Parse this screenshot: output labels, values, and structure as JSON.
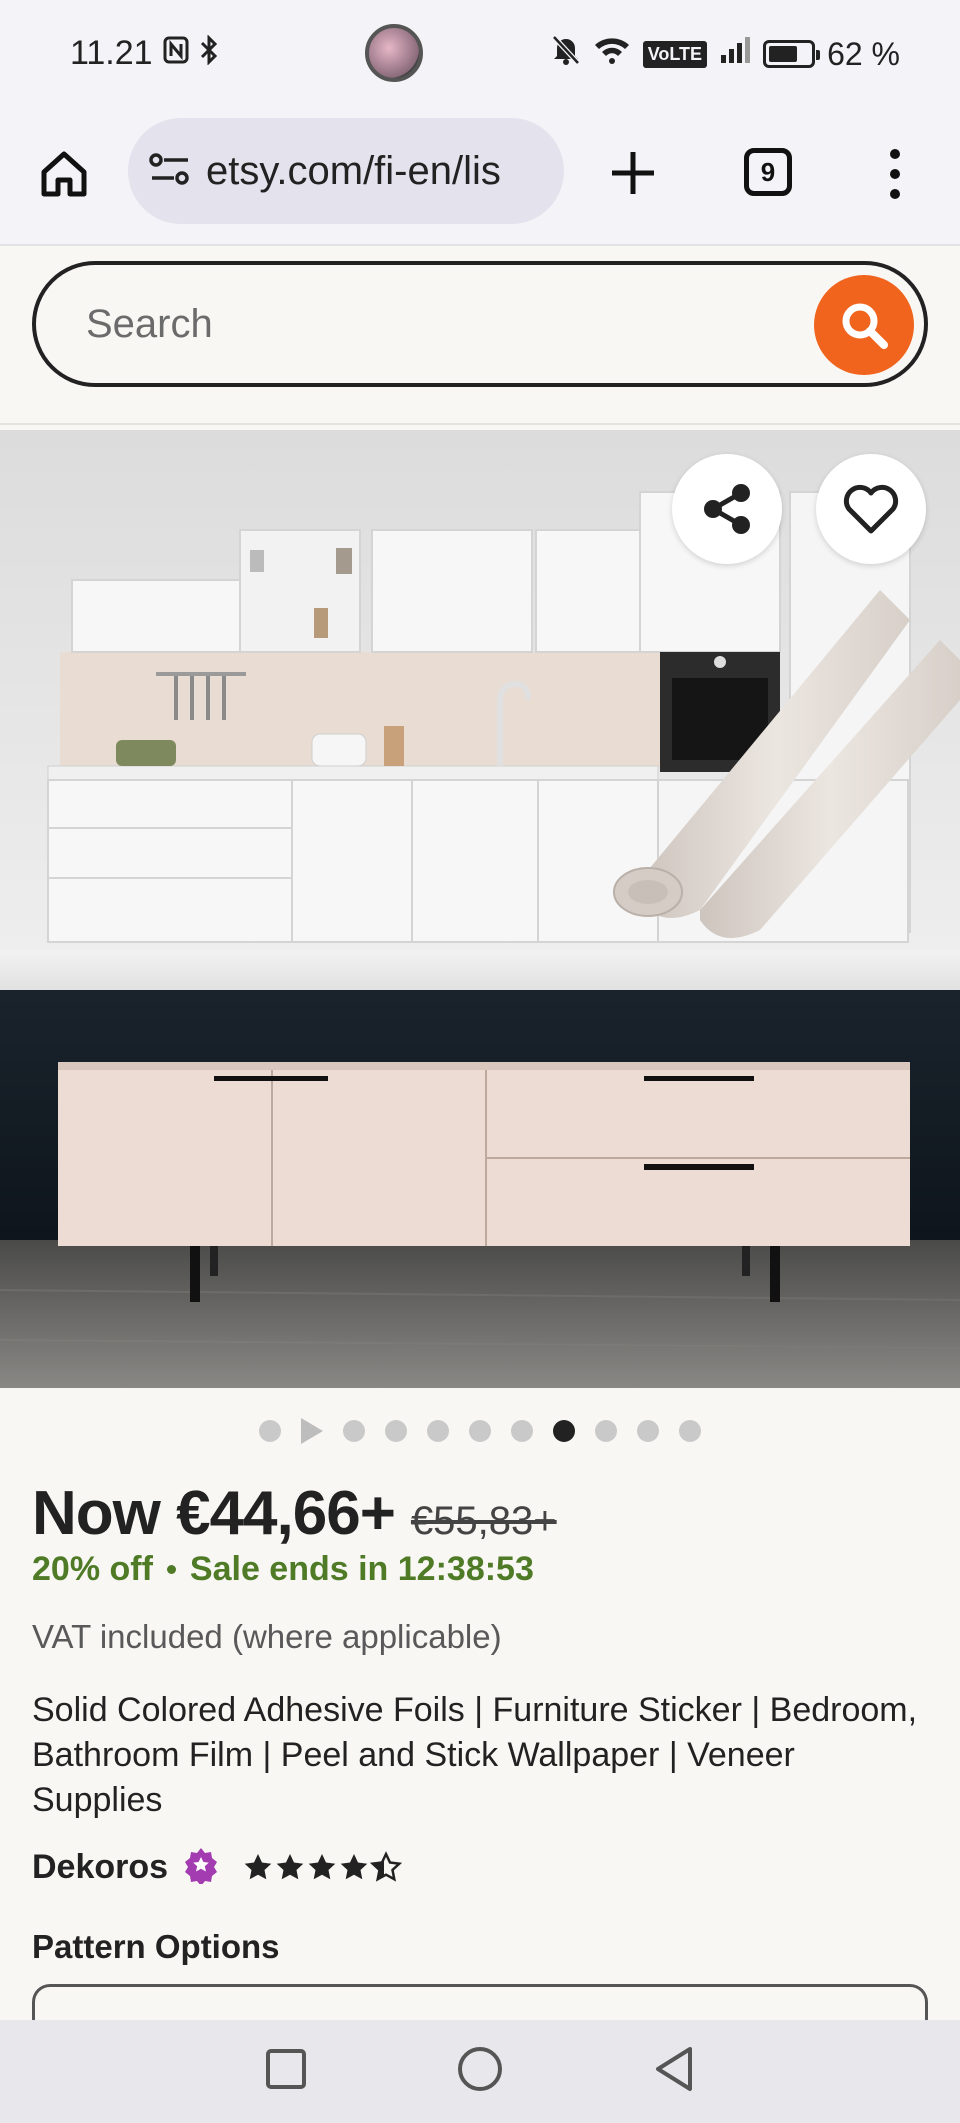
{
  "status_bar": {
    "time": "11.21",
    "battery": "62 %",
    "volte": "VoLTE"
  },
  "browser": {
    "url": "etsy.com/fi-en/lis",
    "tab_count": "9"
  },
  "search": {
    "placeholder": "Search"
  },
  "gallery": {
    "dot_count": 11,
    "active_index": 7
  },
  "listing": {
    "price_now": "Now €44,66+",
    "price_old": "€55,83+",
    "discount": "20% off",
    "sale_ends": "Sale ends in 12:38:53",
    "vat_note": "VAT included (where applicable)",
    "title": "Solid Colored Adhesive Foils | Furniture Sticker | Bedroom, Bathroom Film | Peel and Stick Wallpaper | Veneer Supplies",
    "shop_name": "Dekoros",
    "rating": 4.5,
    "pattern_label": "Pattern Options"
  },
  "colors": {
    "etsy_orange": "#f1641e",
    "sale_green": "#4f7a26",
    "star_seller_purple": "#a23cb0"
  }
}
